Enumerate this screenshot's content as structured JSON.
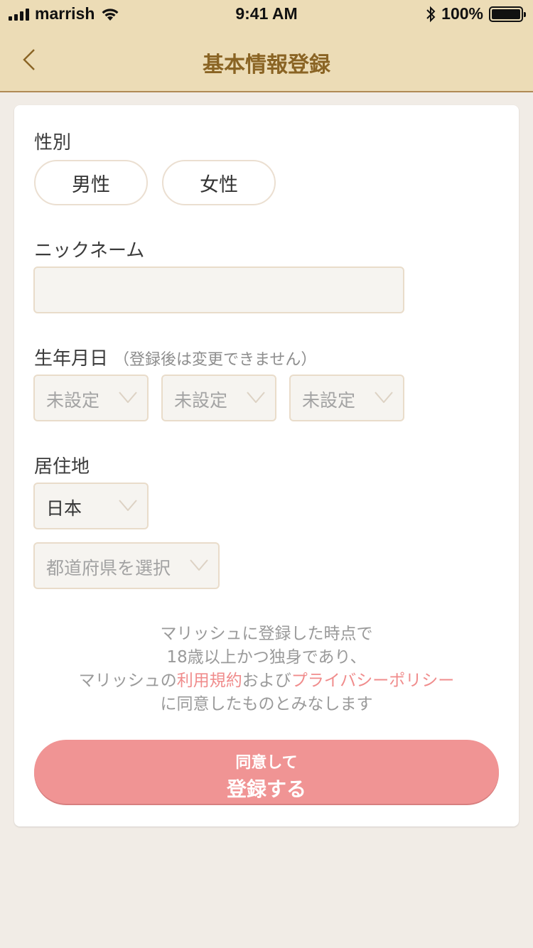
{
  "status_bar": {
    "carrier": "marrish",
    "time": "9:41 AM",
    "battery": "100%",
    "icons": [
      "signal-icon",
      "wifi-icon",
      "bluetooth-icon",
      "battery-icon"
    ]
  },
  "nav": {
    "title": "基本情報登録",
    "back_icon": "chevron-left-icon"
  },
  "form": {
    "gender": {
      "label": "性別",
      "options": [
        "男性",
        "女性"
      ]
    },
    "nickname": {
      "label": "ニックネーム",
      "value": ""
    },
    "birthday": {
      "label": "生年月日",
      "note": "（登録後は変更できません）",
      "year": "未設定",
      "month": "未設定",
      "day": "未設定"
    },
    "residence": {
      "label": "居住地",
      "country": "日本",
      "prefecture_placeholder": "都道府県を選択"
    }
  },
  "terms": {
    "line1": "マリッシュに登録した時点で",
    "line2": "18歳以上かつ独身であり、",
    "line3_prefix": "マリッシュの",
    "terms_link": "利用規約",
    "line3_mid": "および",
    "privacy_link": "プライバシーポリシー",
    "line4": "に同意したものとみなします"
  },
  "submit": {
    "line1": "同意して",
    "line2": "登録する"
  },
  "colors": {
    "header_bg": "#ecdcb6",
    "title": "#8a6424",
    "accent": "#f09494",
    "link": "#f08c8c",
    "background": "#f1ece6"
  }
}
